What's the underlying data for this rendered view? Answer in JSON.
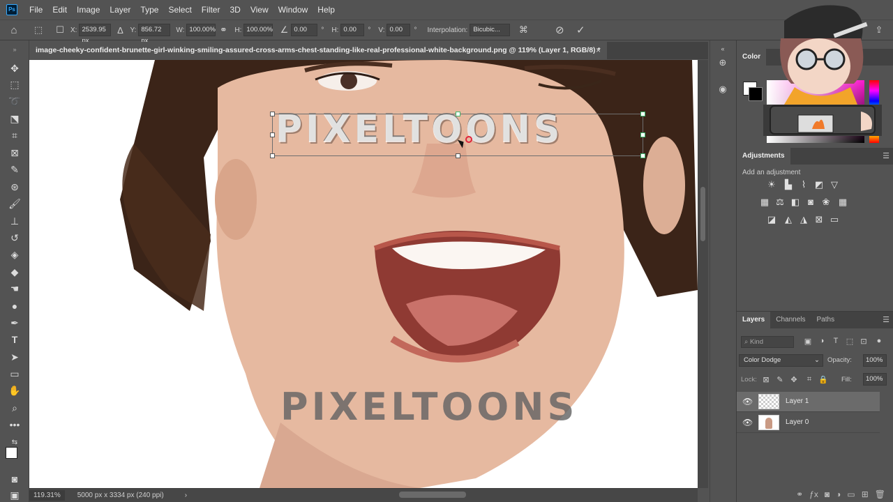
{
  "app": {
    "logo_text": "Ps"
  },
  "menu": [
    "File",
    "Edit",
    "Image",
    "Layer",
    "Type",
    "Select",
    "Filter",
    "3D",
    "View",
    "Window",
    "Help"
  ],
  "options": {
    "x_label": "X:",
    "x_value": "2539.95 px",
    "y_label": "Y:",
    "y_value": "856.72 px",
    "w_label": "W:",
    "w_value": "100.00%",
    "h_label": "H:",
    "h_value": "100.00%",
    "angle_value": "0.00",
    "angle_unit": "°",
    "hskew_label": "H:",
    "hskew_value": "0.00",
    "vskew_label": "V:",
    "vskew_value": "0.00",
    "interpolation_label": "Interpolation:",
    "interpolation_value": "Bicubic..."
  },
  "document": {
    "tab_title": "image-cheeky-confident-brunette-girl-winking-smiling-assured-cross-arms-chest-standing-like-real-professional-white-background.png @ 119% (Layer 1, RGB/8) *",
    "close_symbol": "×"
  },
  "canvas": {
    "watermark_top": "PIXELTOONS",
    "watermark_bottom": "PIXELTOONS"
  },
  "status": {
    "zoom": "119.31%",
    "doc_size": "5000 px x 3334 px (240 ppi)",
    "arrow": "›"
  },
  "panels": {
    "color_tab": "Color",
    "adjustments_tab": "Adjustments",
    "adjustments_subtitle": "Add an adjustment",
    "layers_tabs": [
      "Layers",
      "Channels",
      "Paths"
    ],
    "kind_placeholder": "Kind",
    "blend_mode": "Color Dodge",
    "opacity_label": "Opacity:",
    "opacity_value": "100%",
    "lock_label": "Lock:",
    "fill_label": "Fill:",
    "fill_value": "100%",
    "layers": [
      {
        "name": "Layer 1",
        "selected": true
      },
      {
        "name": "Layer 0",
        "selected": false
      }
    ]
  },
  "colors": {
    "accent": "#31a8ff",
    "panel_bg": "#535353",
    "selected_layer": "#6b6b6b"
  }
}
